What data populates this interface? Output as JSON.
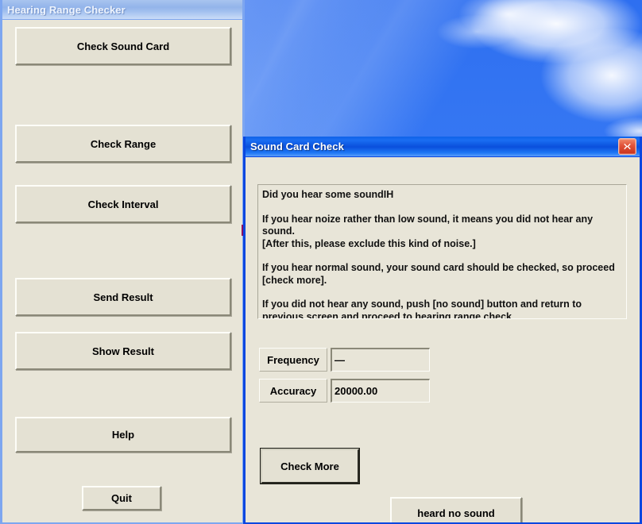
{
  "desktop": {
    "wallpaper_name": "blue-sky-clouds-wallpaper",
    "background_color": "#3a7cf5"
  },
  "main_window": {
    "title": "Hearing Range Checker",
    "active": false,
    "titlebar_color": "#93b4ea",
    "client_color": "#e8e5d8",
    "buttons": [
      {
        "label": "Check Sound Card",
        "name": "check-sound-card-button"
      },
      {
        "label": "Check Range",
        "name": "check-range-button"
      },
      {
        "label": "Check Interval",
        "name": "check-interval-button"
      },
      {
        "label": "Send Result",
        "name": "send-result-button"
      },
      {
        "label": "Show Result",
        "name": "show-result-button"
      },
      {
        "label": "Help",
        "name": "help-button"
      },
      {
        "label": "Quit",
        "name": "quit-button"
      }
    ]
  },
  "dialog": {
    "title": "Sound Card Check",
    "active": true,
    "titlebar_color": "#0a4fdc",
    "close_icon": "close-x-icon",
    "close_button_color": "#c8321c",
    "instructions": {
      "line1": "Did you hear some soundIH",
      "line2": " If you hear noize rather than low sound, it means you did not hear any sound.",
      "line3": "[After this, please exclude this kind of noise.]",
      "line4": " If you hear normal sound, your sound card should be checked, so proceed [check more].",
      "line5": " If you did not hear any sound, push [no sound] button and return to previous screen and proceed to hearing range check."
    },
    "fields": [
      {
        "label": "Frequency",
        "value": "—",
        "name": "frequency"
      },
      {
        "label": "Accuracy",
        "value": "20000.00",
        "name": "accuracy"
      }
    ],
    "buttons": [
      {
        "label": "Check More",
        "name": "check-more-button",
        "focused": true
      },
      {
        "label": "heard no sound",
        "name": "heard-no-sound-button",
        "focused": false
      }
    ]
  }
}
